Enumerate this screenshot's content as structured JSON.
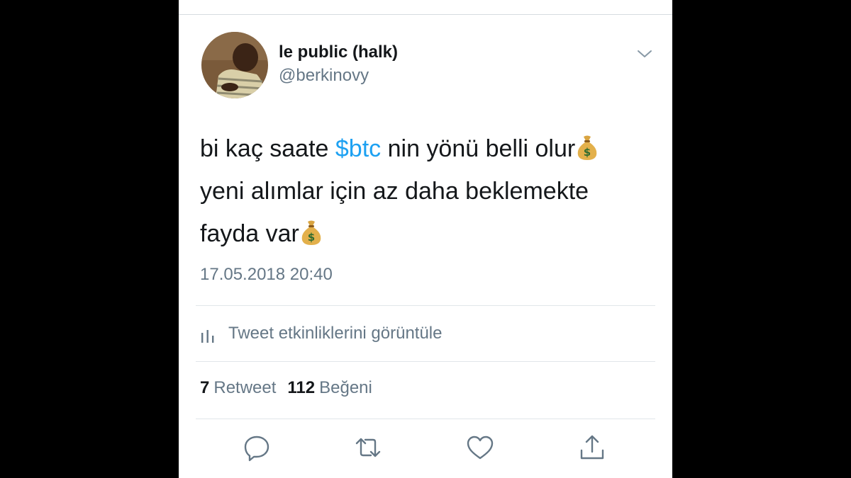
{
  "tweet": {
    "display_name": "le public (halk)",
    "handle": "@berkinovy",
    "text": {
      "part1": "bi kaç saate ",
      "cashtag": "$btc",
      "part2": " nin yönü belli olur",
      "part3": "yeni alımlar için az daha beklemekte fayda var"
    },
    "emoji": "money-bag",
    "timestamp": "17.05.2018 20:40",
    "activity_label": "Tweet etkinliklerini görüntüle",
    "stats": {
      "retweets_count": "7",
      "retweets_label": "Retweet",
      "likes_count": "112",
      "likes_label": "Beğeni"
    }
  },
  "colors": {
    "link_blue": "#1da1f2",
    "text_primary": "#14171a",
    "text_secondary": "#657786",
    "icon_gray": "#657786",
    "divider": "#e1e6ea"
  },
  "icons": [
    "chevron-down-icon",
    "analytics-bars-icon",
    "reply-icon",
    "retweet-icon",
    "like-icon",
    "share-icon",
    "money-bag-emoji"
  ]
}
